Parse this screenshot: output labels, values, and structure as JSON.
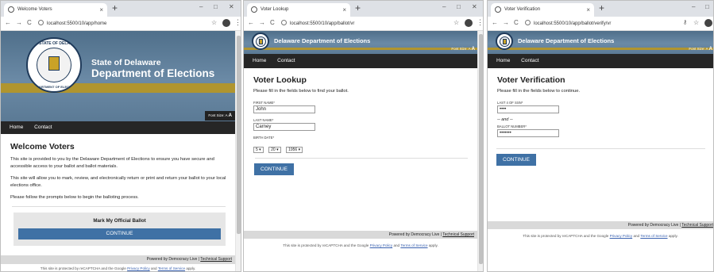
{
  "windows": [
    {
      "tab_title": "Welcome Voters",
      "url": "localhost:5500/10/app/home",
      "org_line1": "State of Delaware",
      "org_line2": "Department of Elections",
      "seal_top": "STATE OF DELAWARE",
      "seal_bottom": "DEPARTMENT OF ELECTIONS",
      "font_size_label": "Font Size: A",
      "font_size_big": "A",
      "nav": [
        "Home",
        "Contact"
      ],
      "heading": "Welcome Voters",
      "paragraphs": [
        "This site is provided to you by the Delaware Department of Elections to ensure you have secure and accessible access to your ballot and ballot materials.",
        "This site will allow you to mark, review, and electronically return or print and return your ballot to your local elections office.",
        "Please follow the prompts below to begin the balloting process."
      ],
      "card_title": "Mark My Official Ballot",
      "button": "CONTINUE",
      "footer_text": "Powered by Democracy Live |",
      "footer_link": "Technical Support",
      "recaptcha_pre": "This site is protected by reCAPTCHA and the Google",
      "privacy": "Privacy Policy",
      "and": "and",
      "terms": "Terms of Service",
      "apply": "apply."
    },
    {
      "tab_title": "Voter Lookup",
      "url": "localhost:5500/10/app/ballot/vr",
      "org_title": "Delaware Department of Elections",
      "font_size_label": "Font Size: A",
      "font_size_big": "A",
      "nav": [
        "Home",
        "Contact"
      ],
      "heading": "Voter Lookup",
      "intro": "Please fill in the fields below to find your ballot.",
      "first_name_label": "FIRST NAME*",
      "first_name_value": "John",
      "last_name_label": "LAST NAME*",
      "last_name_value": "Carney",
      "birth_date_label": "BIRTH DATE*",
      "birth_month": "5",
      "birth_day": "20",
      "birth_year": "1956",
      "button": "CONTINUE",
      "footer_text": "Powered by Democracy Live |",
      "footer_link": "Technical Support",
      "recaptcha_pre": "This site is protected by reCAPTCHA and the Google",
      "privacy": "Privacy Policy",
      "and": "and",
      "terms": "Terms of Service",
      "apply": "apply."
    },
    {
      "tab_title": "Voter Verification",
      "url": "localhost:5500/10/app/ballot/verify/vr",
      "org_title": "Delaware Department of Elections",
      "font_size_label": "Font Size: A",
      "font_size_big": "A",
      "nav": [
        "Home",
        "Contact"
      ],
      "heading": "Voter Verification",
      "intro": "Please fill in the fields below to continue.",
      "ssn_label": "LAST 4 OF SSN*",
      "ssn_value": "••••",
      "and_text": "-- and --",
      "ballot_label": "BALLOT NUMBER*",
      "ballot_value": "•••••••",
      "button": "CONTINUE",
      "footer_text": "Powered by Democracy Live |",
      "footer_link": "Technical Support",
      "recaptcha_pre": "This site is protected by reCAPTCHA and the Google",
      "privacy": "Privacy Policy",
      "and": "and",
      "terms": "Terms of Service",
      "apply": "apply."
    }
  ],
  "browser": {
    "close": "×",
    "new_tab": "+",
    "minimize": "–",
    "maximize": "□",
    "window_close": "✕",
    "back": "←",
    "forward": "→",
    "reload": "C",
    "star": "☆",
    "menu": "⋮"
  },
  "colors": {
    "header_blue": "#5b7a95",
    "gold_stripe": "#b0952f",
    "nav_dark": "#262626",
    "button_blue": "#3f71a5",
    "footer_gray": "#d9d9d9"
  }
}
